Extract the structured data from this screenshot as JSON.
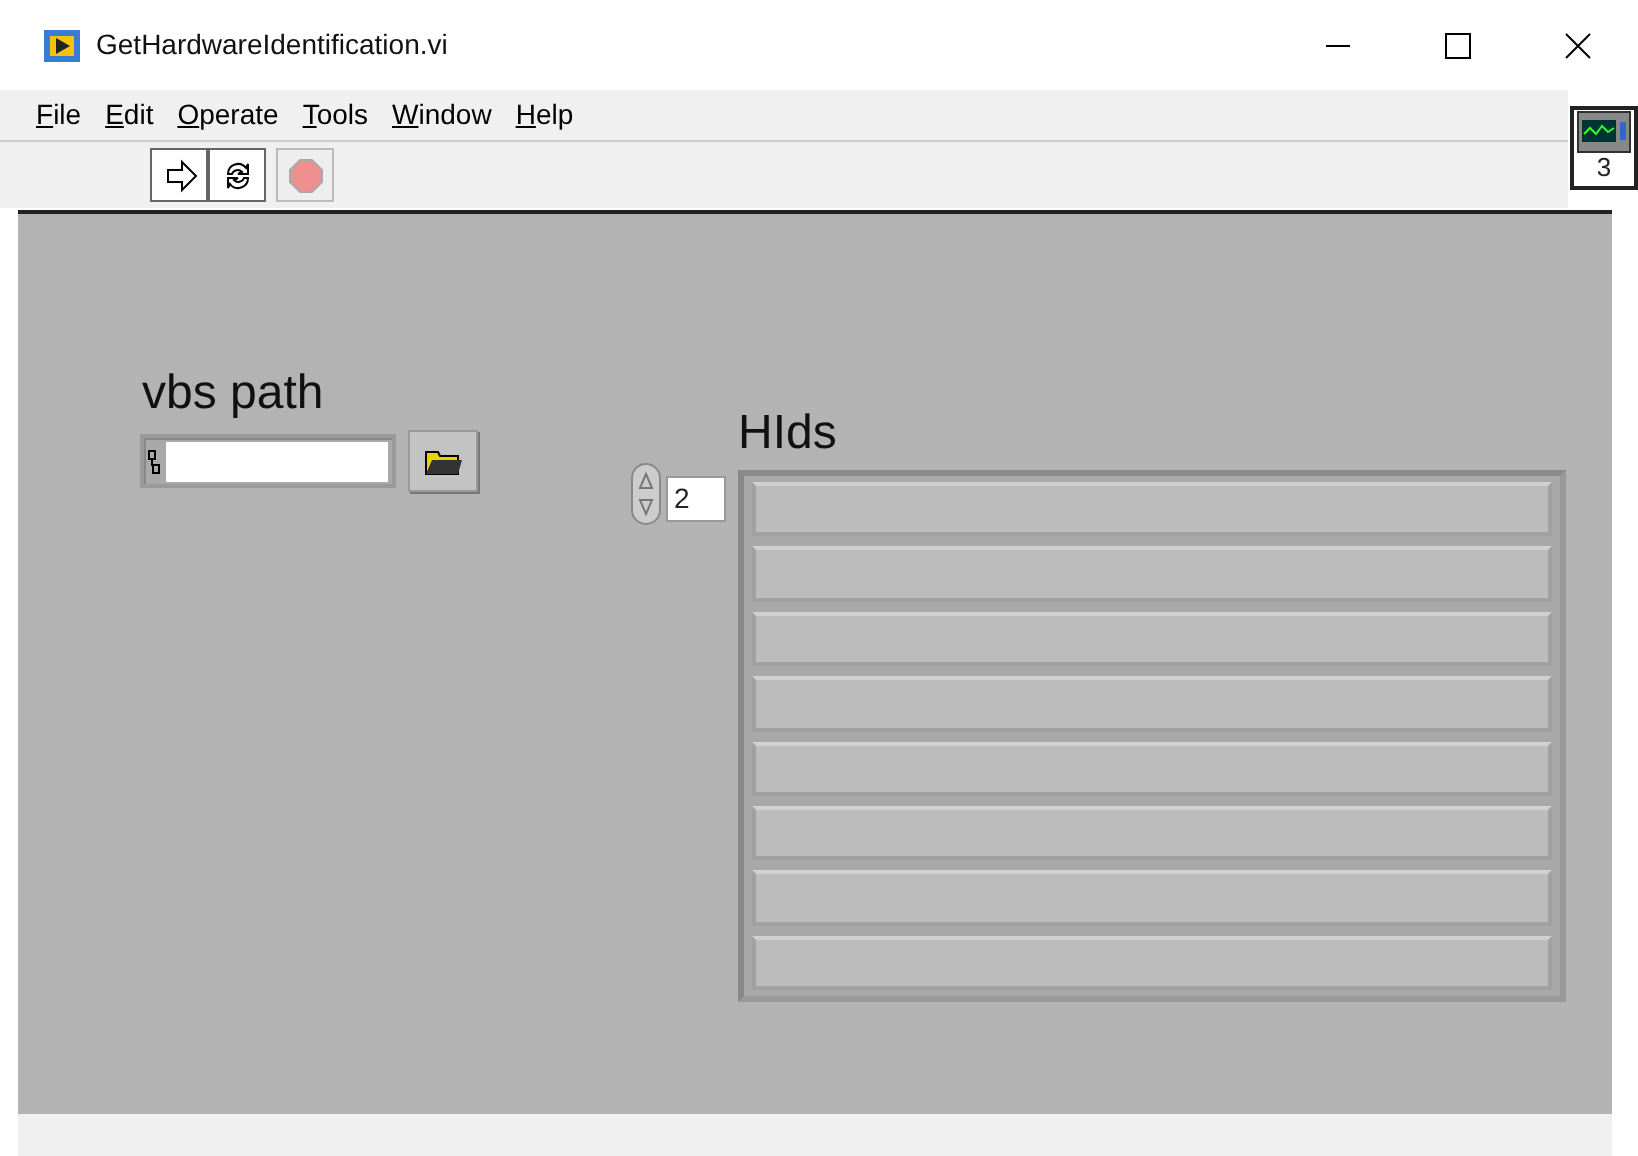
{
  "window": {
    "title": "GetHardwareIdentification.vi"
  },
  "menu": [
    {
      "label": "File"
    },
    {
      "label": "Edit"
    },
    {
      "label": "Operate"
    },
    {
      "label": "Tools"
    },
    {
      "label": "Window"
    },
    {
      "label": "Help"
    }
  ],
  "toolbar": [
    {
      "kind": "run",
      "disabled": false
    },
    {
      "kind": "run-continuously",
      "disabled": false
    },
    {
      "kind": "abort",
      "disabled": true
    }
  ],
  "connector_pane": {
    "label": "3"
  },
  "front_panel": {
    "path_control": {
      "label": "vbs path"
    },
    "array": {
      "label": "HIds",
      "index": "2",
      "elements": [
        {
          "kind": "string"
        },
        {
          "kind": "string"
        },
        {
          "kind": "string"
        },
        {
          "kind": "string"
        },
        {
          "kind": "string"
        },
        {
          "kind": "string"
        },
        {
          "kind": "string"
        },
        {
          "kind": "string"
        }
      ]
    }
  }
}
